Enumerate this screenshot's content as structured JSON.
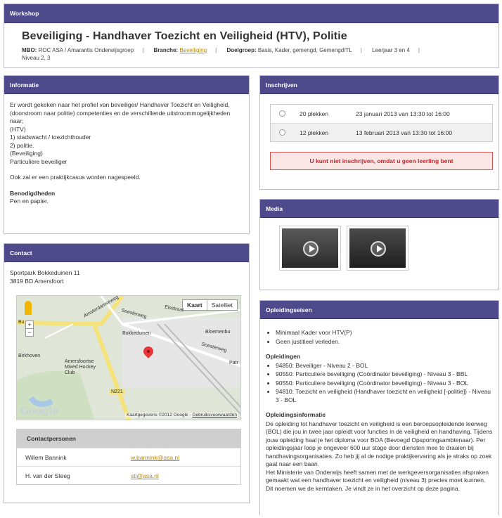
{
  "workshop": {
    "header": "Workshop",
    "title": "Beveiliging - Handhaver Toezicht en Veiligheid (HTV), Politie",
    "mbo_label": "MBO:",
    "mbo_value": "ROC ASA / Amarantis Onderwijsgroep",
    "branche_label": "Branche:",
    "branche_value": "Beveiliging",
    "doelgroep_label": "Doelgroep:",
    "doelgroep_value": "Basis, Kader, gemengd, Gemengd/TL",
    "leerjaar": "Leerjaar 3 en 4",
    "niveau": "Niveau 2, 3"
  },
  "informatie": {
    "header": "Informatie",
    "lines": [
      "Er wordt gekeken naar het profiel van beveiliger/ Handhaver Toezicht en Veiligheid,(doorstroom naar politie)  competenties en de verschillende uitstroommogelijkheden naar;",
      "(HTV)",
      "1) stadswacht / toezichthouder",
      "2) politie.",
      "(Beveiliging)",
      "Particuliere beveiliger"
    ],
    "praktijk": "Ook zal er een praktijkcasus worden nagespeeld.",
    "benodigdheden_label": "Benodigdheden",
    "benodigdheden_value": "Pen en papier."
  },
  "contact": {
    "header": "Contact",
    "address_line1": "Sportpark Bokkeduinen 11",
    "address_line2": "3819 BD Amersfoort",
    "map": {
      "btn_kaart": "Kaart",
      "btn_satelliet": "Satelliet",
      "labels": [
        "Amsterdamseweg",
        "Soesterweg",
        "Bokkeduinen",
        "Bloemenbu",
        "Birkhoven",
        "Amersfoortse Mixed Hockey Club",
        "N221",
        "Elsstraat",
        "Soesterweg",
        "Patr",
        "Bu"
      ],
      "google": "Google",
      "copyright": "Kaartgegevens ©2012 Google - ",
      "terms": "Gebruiksvoorwaarden"
    },
    "persons_header": "Contactpersonen",
    "persons": [
      {
        "name": "Willem Bannink",
        "email": "w.bannink@asa.nl"
      },
      {
        "name": "H. van der Steeg",
        "email": "sti@asa.nl"
      }
    ]
  },
  "inschrijven": {
    "header": "Inschrijven",
    "slots": [
      {
        "places": "20 plekken",
        "date": "23 januari 2013 van 13:30 tot 16:00"
      },
      {
        "places": "12 plekken",
        "date": "13 februari 2013 van 13:30 tot 16:00"
      }
    ],
    "notice": "U kunt niet inschrijven, omdat u geen leerling bent"
  },
  "media": {
    "header": "Media"
  },
  "opleidingseisen": {
    "header": "Opleidingseisen",
    "requirements": [
      "Minimaal Kader voor HTV(P)",
      "Geen justitieel verleden."
    ],
    "opleidingen_label": "Opleidingen",
    "opleidingen": [
      "94850: Beveiliger - Niveau 2 - BOL",
      "90550: Particuliere beveiliging (Coördinator beveiliging) - Niveau 3 - BBL",
      "90550: Particuliere beveiliging (Coördinator beveiliging) - Niveau 3 - BOL",
      "94810: Toezicht en veiligheid (Handhaver toezicht en veiligheid [-politie]) - Niveau 3 - BOL"
    ],
    "info_label": "Opleidingsinformatie",
    "info_text": "De opleiding tot handhaver toezicht en veiligheid is een beroepsopleidende leerweg (BOL) die jou in twee jaar opleidt voor functies in de veiligheid en handhaving.  Tijdens jouw opleiding haal je het diploma voor BOA (Bevoegd Opsporingsambtenaar). Per opleidingsjaar loop je ongeveer 600 uur stage door diensten mee te draaien bij handhavingsorganisaties.  Zo heb jij al de nodige praktijkervaring als je straks op zoek gaat naar een baan.",
    "info_text2": "Het Ministerie van Onderwijs heeft samen met de werkgeversorganisaties afspraken gemaakt wat een handhaver toezicht en veiligheid (niveau 3) precies moet kunnen. Dit noemen we de kerntaken. Je vindt ze in het overzicht op deze pagina."
  }
}
